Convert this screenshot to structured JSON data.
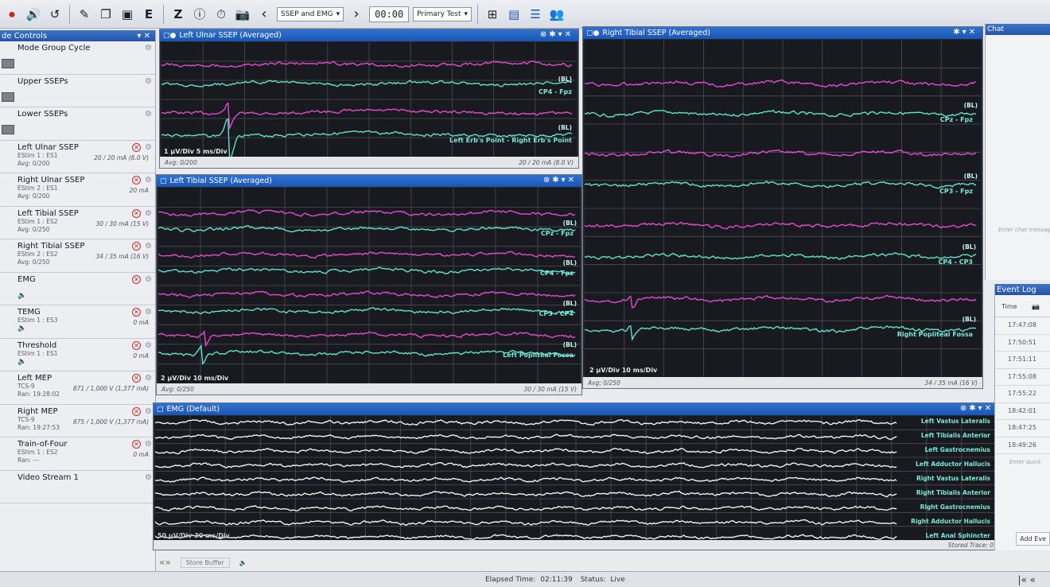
{
  "toolbar": {
    "mode_select": "SSEP and EMG",
    "timer": "00:00",
    "test_select": "Primary Test",
    "letter_z": "Z",
    "letter_e": "E"
  },
  "left_panel": {
    "title": "de Controls",
    "controls": [
      {
        "name": "Mode Group Cycle",
        "sub1": "",
        "sub2": "",
        "value": "",
        "x": false
      },
      {
        "name": "Upper SSEPs",
        "sub1": "",
        "sub2": "",
        "value": "",
        "x": false
      },
      {
        "name": "Lower SSEPs",
        "sub1": "",
        "sub2": "",
        "value": "",
        "x": false
      },
      {
        "name": "Left Ulnar SSEP",
        "sub1": "EStim 1 : ES1",
        "sub2": "Avg: 0/200",
        "value": "20 / 20 mA (8.0 V)",
        "x": true
      },
      {
        "name": "Right Ulnar SSEP",
        "sub1": "EStim 2 : ES1",
        "sub2": "Avg: 0/200",
        "value": "20 mA",
        "x": true
      },
      {
        "name": "Left Tibial SSEP",
        "sub1": "EStim 1 : ES2",
        "sub2": "Avg: 0/250",
        "value": "30 / 30 mA (15 V)",
        "x": true
      },
      {
        "name": "Right Tibial SSEP",
        "sub1": "EStim 2 : ES2",
        "sub2": "Avg: 0/250",
        "value": "34 / 35 mA (16 V)",
        "x": true
      },
      {
        "name": "EMG",
        "sub1": "",
        "sub2": "",
        "value": "",
        "x": true
      },
      {
        "name": "TEMG",
        "sub1": "EStim 1 : ES3",
        "sub2": "",
        "value": "0 mA",
        "x": true
      },
      {
        "name": "Threshold",
        "sub1": "EStim 1 : ES1",
        "sub2": "",
        "value": "0 mA",
        "x": true
      },
      {
        "name": "Left MEP",
        "sub1": "TCS-9",
        "sub2": "Ran: 19:28:02",
        "value": "871 / 1,000 V (1,377 mA)",
        "x": true
      },
      {
        "name": "Right MEP",
        "sub1": "TCS-9",
        "sub2": "Ran: 19:27:53",
        "value": "875 / 1,000 V (1,377 mA)",
        "x": true
      },
      {
        "name": "Train-of-Four",
        "sub1": "EStim 1 : ES2",
        "sub2": "Ran: ---",
        "value": "0 mA",
        "x": true
      },
      {
        "name": "Video Stream 1",
        "sub1": "",
        "sub2": "",
        "value": "",
        "x": false
      }
    ]
  },
  "panels": {
    "left_ulnar": {
      "title": "Left Ulnar SSEP (Averaged)",
      "labels": [
        "CP4 - Fpz",
        "Left Erb's Point - Right Erb's Point"
      ],
      "bl": "(BL)",
      "scale": "1 µV/Div    5 ms/Div",
      "footer_left": "Avg: 0/200",
      "footer_right": "20 / 20 mA (8.0 V)"
    },
    "left_tibial": {
      "title": "Left Tibial SSEP (Averaged)",
      "labels": [
        "CPz - Fpz",
        "CP4 - Fpz",
        "CP3 - CP4",
        "Left Popliteal Fossa"
      ],
      "bl": "(BL)",
      "scale": "2 µV/Div    10 ms/Div",
      "footer_left": "Avg: 0/250",
      "footer_right": "30 / 30 mA (15 V)"
    },
    "right_tibial": {
      "title": "Right Tibial SSEP (Averaged)",
      "labels": [
        "CPz - Fpz",
        "CP3 - Fpz",
        "CP4 - CP3",
        "Right Popliteal Fossa"
      ],
      "bl": "(BL)",
      "scale": "2 µV/Div    10 ms/Div",
      "footer_left": "Avg: 0/250",
      "footer_right": "34 / 35 mA (16 V)"
    },
    "emg": {
      "title": "EMG (Default)",
      "channels": [
        "Left Vastus Lateralis",
        "Left Tibialis Anterior",
        "Left Gastrocnemius",
        "Left Adductor Hallucis",
        "Right Vastus Lateralis",
        "Right Tibialis Anterior",
        "Right Gastrocnemius",
        "Right Adductor Hallucis",
        "Left Anal Sphincter"
      ],
      "scale": "50 µV/Div    30 ms/Div",
      "footer_right": "Stored Trace: 0"
    }
  },
  "chat": {
    "title": "Chat",
    "placeholder": "Enter chat message"
  },
  "event_log": {
    "title": "Event Log",
    "col_time": "Time",
    "times": [
      "17:47:08",
      "17:50:51",
      "17:51:11",
      "17:55:08",
      "17:55:22",
      "18:42:01",
      "18:47:25",
      "18:49:26"
    ],
    "quick_placeholder": "Enter quick",
    "add_button": "Add Eve"
  },
  "bottom": {
    "store_buffer": "Store Buffer"
  },
  "status": {
    "elapsed_label": "Elapsed Time:",
    "elapsed": "02:11:39",
    "status_label": "Status:",
    "status": "Live"
  },
  "colors": {
    "magenta": "#e34bd0",
    "cyan": "#5fe3cc",
    "white": "#f1f1f1",
    "title_blue": "#1b55b4"
  }
}
